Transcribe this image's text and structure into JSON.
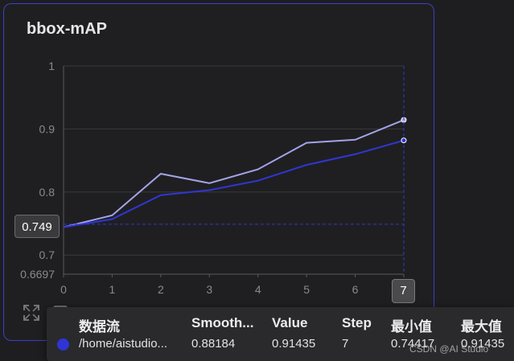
{
  "card": {
    "title": "bbox-mAP"
  },
  "colors": {
    "smoothed_line": "#3136d4",
    "raw_line": "#a3a3e8",
    "grid": "#3a3a3c",
    "card_border": "#3b3fc9"
  },
  "chart_data": {
    "type": "line",
    "title": "bbox-mAP",
    "xlabel": "",
    "ylabel": "",
    "x": [
      0,
      1,
      2,
      3,
      4,
      5,
      6,
      7
    ],
    "x_ticks": [
      "0",
      "1",
      "2",
      "3",
      "4",
      "5",
      "6",
      "7"
    ],
    "y_ticks": [
      "1",
      "0.9",
      "0.8",
      "0.7",
      "0.6697"
    ],
    "ylim": [
      0.6697,
      1.0
    ],
    "xlim": [
      0,
      7
    ],
    "grid": true,
    "series": [
      {
        "name": "/home/aistudio...",
        "style": "raw",
        "values": [
          0.7442,
          0.763,
          0.829,
          0.814,
          0.836,
          0.878,
          0.883,
          0.91435
        ]
      },
      {
        "name": "/home/aistudio...",
        "style": "smoothed",
        "values": [
          0.7442,
          0.757,
          0.795,
          0.803,
          0.818,
          0.843,
          0.86,
          0.88184
        ]
      }
    ],
    "hover": {
      "x_label": "7",
      "y_label": "0.749",
      "y_value": 0.749
    }
  },
  "tooltip": {
    "headers": [
      "数据流",
      "Smooth...",
      "Value",
      "Step",
      "最小值",
      "最大值"
    ],
    "row": [
      "/home/aistudio...",
      "0.88184",
      "0.91435",
      "7",
      "0.74417",
      "0.91435"
    ]
  },
  "watermark": "CSDN @AI Studio",
  "icons": [
    "fullscreen-icon",
    "checkbox-icon"
  ]
}
